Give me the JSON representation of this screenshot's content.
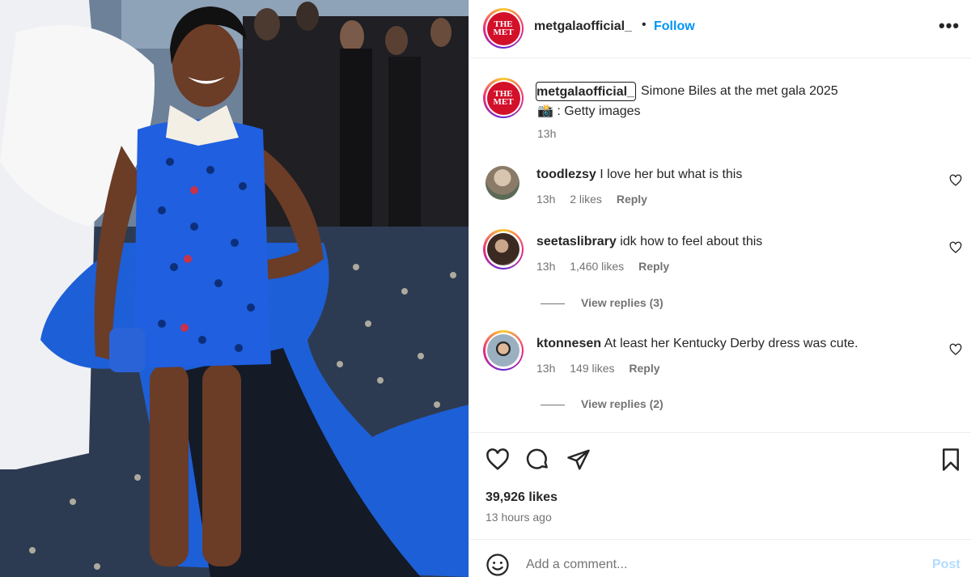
{
  "post": {
    "username": "metgalaofficial_",
    "follow_label": "Follow",
    "separator": "•",
    "more_label": "•••",
    "avatar_logo_top": "THE",
    "avatar_logo_bottom": "MET"
  },
  "caption": {
    "username": "metgalaofficial_",
    "text": "Simone Biles at the met gala 2025",
    "line2": "📸 : Getty images",
    "time": "13h"
  },
  "comments": [
    {
      "username": "toodlezsy",
      "text": "I love her but what is this",
      "time": "13h",
      "likes": "2 likes",
      "reply": "Reply"
    },
    {
      "username": "seetaslibrary",
      "text": "idk how to feel about this",
      "time": "13h",
      "likes": "1,460 likes",
      "reply": "Reply",
      "view_replies": "View replies (3)"
    },
    {
      "username": "ktonnesen",
      "text": "At least her Kentucky Derby dress was cute.",
      "time": "13h",
      "likes": "149 likes",
      "reply": "Reply",
      "view_replies": "View replies (2)"
    }
  ],
  "actions": {
    "likes": "39,926 likes",
    "time_ago": "13 hours ago"
  },
  "comment_box": {
    "placeholder": "Add a comment...",
    "post_label": "Post"
  },
  "icons": [
    "heart-icon",
    "comment-icon",
    "share-icon",
    "bookmark-icon",
    "emoji-icon",
    "more-icon"
  ],
  "colors": {
    "follow": "#0095f6",
    "post_disabled": "#b3dbff",
    "muted": "#737373",
    "met_red": "#d3102a"
  }
}
